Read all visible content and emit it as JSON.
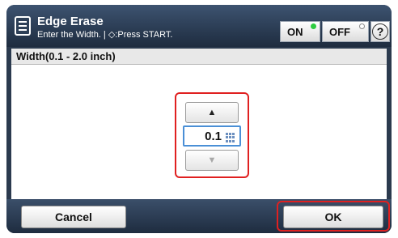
{
  "header": {
    "title": "Edge Erase",
    "subtitle": "Enter the Width. | ◇:Press START.",
    "toggle_on_label": "ON",
    "toggle_off_label": "OFF",
    "help_label": "?"
  },
  "content": {
    "section_label": "Width(0.1 - 2.0 inch)",
    "up_arrow": "▲",
    "down_arrow": "▼",
    "width_value": "0.1"
  },
  "footer": {
    "cancel_label": "Cancel",
    "ok_label": "OK"
  },
  "colors": {
    "highlight": "#e02020",
    "header_bg": "#2b3a4e",
    "on_led": "#2ecc40",
    "field_border": "#4a8fd6"
  },
  "icons": {
    "mode_icon": "document-icon",
    "keypad_icon": "keypad-icon",
    "help_icon": "help-icon"
  }
}
